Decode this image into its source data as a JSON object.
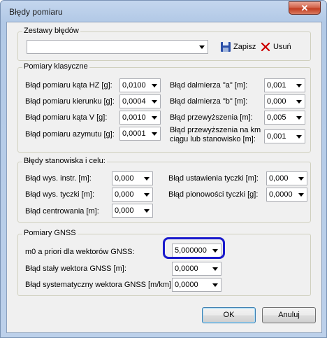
{
  "window": {
    "title": "Błędy pomiaru",
    "close_glyph": "✕"
  },
  "zestawy": {
    "legend": "Zestawy błędów",
    "value": "",
    "zapisz": "Zapisz",
    "usun": "Usuń",
    "icon_zapisz": "floppy-disk-icon",
    "icon_usun": "red-x-icon",
    "usun_color": "#cc0000"
  },
  "klasyczne": {
    "legend": "Pomiary klasyczne",
    "left": [
      {
        "label": "Błąd pomiaru kąta HZ [g]:",
        "value": "0,0100"
      },
      {
        "label": "Błąd pomiaru kierunku [g]:",
        "value": "0,0004"
      },
      {
        "label": "Błąd pomiaru kąta V [g]:",
        "value": "0,0010"
      },
      {
        "label": "Błąd pomiaru azymutu [g]:",
        "value": "0,0001"
      }
    ],
    "right": [
      {
        "label": "Błąd dalmierza \"a\" [m]:",
        "value": "0,001"
      },
      {
        "label": "Błąd dalmierza \"b\" [m]:",
        "value": "0,000"
      },
      {
        "label": "Błąd przewyższenia  [m]:",
        "value": "0,005"
      },
      {
        "label1": "Błąd przewyższenia na km",
        "label2": "ciągu lub stanowisko [m]:",
        "value": "0,001"
      }
    ]
  },
  "stanowiska": {
    "legend": "Błędy stanowiska i celu:",
    "left": [
      {
        "label": "Błąd wys. instr. [m]:",
        "value": "0,000"
      },
      {
        "label": "Błąd wys. tyczki [m]:",
        "value": "0,000"
      },
      {
        "label": "Błąd centrowania [m]:",
        "value": "0,000"
      }
    ],
    "right": [
      {
        "label": "Błąd ustawienia tyczki [m]:",
        "value": "0,000"
      },
      {
        "label": "Błąd pionowości tyczki [g]:",
        "value": "0,0000"
      }
    ]
  },
  "gnss": {
    "legend": "Pomiary GNSS",
    "rows": [
      {
        "label": "m0 a priori dla wektorów GNSS:",
        "value": "5,000000"
      },
      {
        "label": "Błąd stały wektora GNSS [m]:",
        "value": "0,0000"
      },
      {
        "label": "Błąd systematyczny wektora GNSS [m/km]:",
        "value": "0,0000"
      }
    ],
    "highlight_color": "#1a1acc"
  },
  "buttons": {
    "ok": "OK",
    "cancel": "Anuluj"
  }
}
